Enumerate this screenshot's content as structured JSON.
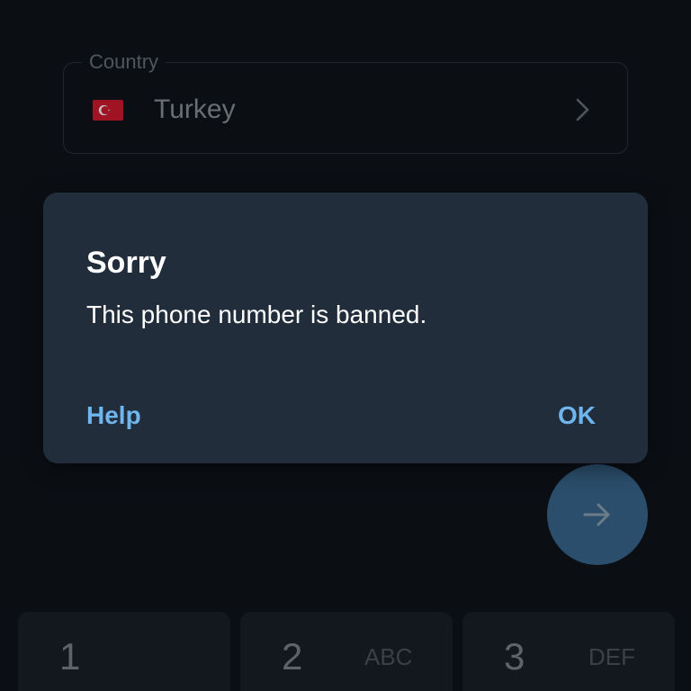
{
  "country_field": {
    "label": "Country",
    "value": "Turkey",
    "flag_icon": "turkey-flag-icon"
  },
  "dialog": {
    "title": "Sorry",
    "message": "This phone number is banned.",
    "help_label": "Help",
    "ok_label": "OK"
  },
  "fab": {
    "icon": "arrow-right-icon"
  },
  "keypad": {
    "keys": [
      {
        "number": "1",
        "letters": ""
      },
      {
        "number": "2",
        "letters": "ABC"
      },
      {
        "number": "3",
        "letters": "DEF"
      }
    ]
  },
  "colors": {
    "background": "#0f141b",
    "dialog": "#222d3b",
    "accent": "#6fb6ee",
    "fab": "#3a6890",
    "key": "#1a2029"
  }
}
